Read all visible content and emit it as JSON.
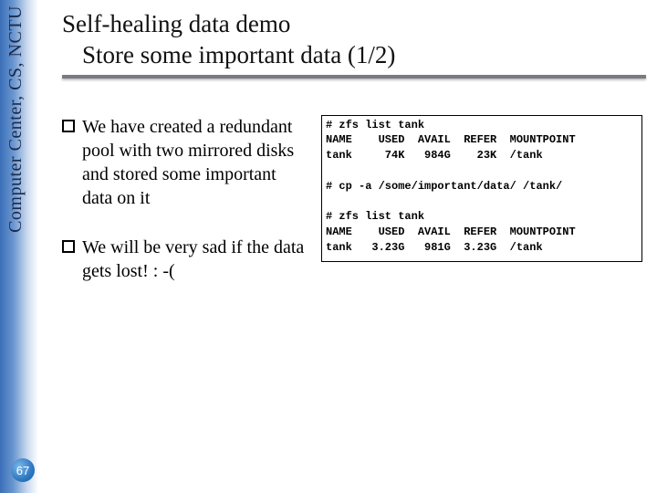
{
  "sidebar": {
    "label": "Computer Center, CS, NCTU"
  },
  "slide_number": "67",
  "title": {
    "line1": "Self-healing data demo",
    "line2": "Store some important data (1/2)"
  },
  "bullets": [
    "We have created a redundant pool with two mirrored disks and stored some important data on it",
    "We will be very sad if the data gets lost! : -("
  ],
  "terminal": {
    "cmd1": "# zfs list tank",
    "hdr1": "NAME    USED  AVAIL  REFER  MOUNTPOINT",
    "row1": "tank     74K   984G    23K  /tank",
    "blank1": "",
    "cmd2": "# cp -a /some/important/data/ /tank/",
    "blank2": "",
    "cmd3": "# zfs list tank",
    "hdr2": "NAME    USED  AVAIL  REFER  MOUNTPOINT",
    "row2": "tank   3.23G   981G  3.23G  /tank"
  }
}
